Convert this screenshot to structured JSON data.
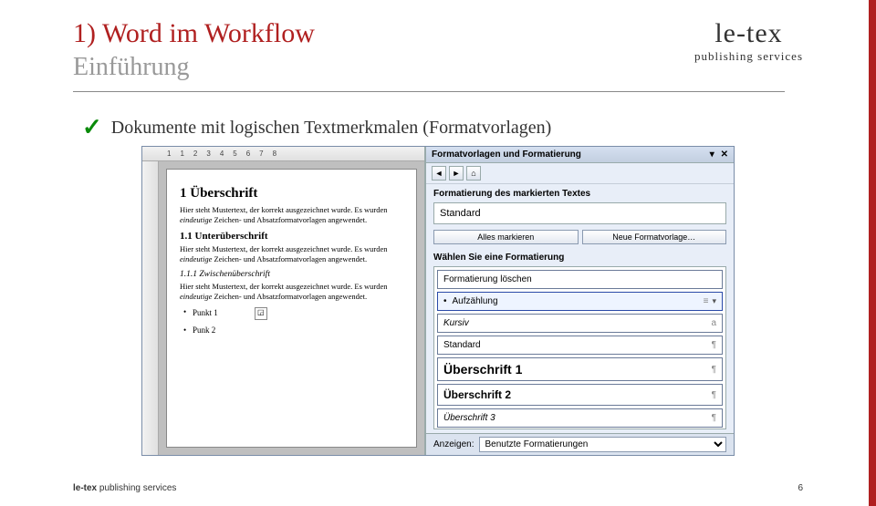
{
  "slide": {
    "title": "1) Word im Workflow",
    "subtitle": "Einführung",
    "bullet": "Dokumente mit logischen Textmerkmalen (Formatvorlagen)"
  },
  "logo": {
    "main": "le-tex",
    "sub": "publishing services"
  },
  "ruler": [
    "1",
    "1",
    "2",
    "3",
    "4",
    "5",
    "6",
    "7",
    "8"
  ],
  "doc": {
    "h1": "1 Überschrift",
    "p1a": "Hier steht Mustertext, der korrekt ausgezeichnet wurde. Es wurden ",
    "p1_em": "eindeutige",
    "p1b": " Zeichen- und Absatzformatvorlagen angewendet.",
    "h2": "1.1 Unterüberschrift",
    "p2a": "Hier steht Mustertext, der korrekt ausgezeichnet wurde. Es wurden ",
    "p2_em": "eindeutige",
    "p2b": " Zeichen- und Absatzformatvorlagen angewendet.",
    "h3": "1.1.1 Zwischenüberschrift",
    "p3a": "Hier steht Mustertext, der korrekt ausgezeichnet wurde. Es wurden ",
    "p3_em": "eindeutige",
    "p3b": " Zeichen- und Absatzformatvorlagen angewendet.",
    "b1": "Punkt 1",
    "b2": "Punk 2"
  },
  "taskpane": {
    "title": "Formatvorlagen und Formatierung",
    "section_current": "Formatierung des markierten Textes",
    "current_style": "Standard",
    "btn_select_all": "Alles markieren",
    "btn_new_style": "Neue Formatvorlage…",
    "section_pick": "Wählen Sie eine Formatierung",
    "items": [
      {
        "label": "Formatierung löschen",
        "mark": ""
      },
      {
        "label": "Aufzählung",
        "mark": "≡",
        "bul": "•",
        "selected": true
      },
      {
        "label": "Kursiv",
        "mark": "a",
        "kurs": true
      },
      {
        "label": "Standard",
        "mark": "¶"
      },
      {
        "label": "Überschrift 1",
        "mark": "¶",
        "big": true
      },
      {
        "label": "Überschrift 2",
        "mark": "¶",
        "mid": true
      },
      {
        "label": "Überschrift 3",
        "mark": "¶",
        "ital": true
      }
    ],
    "show_label": "Anzeigen:",
    "show_value": "Benutzte Formatierungen"
  },
  "footer": {
    "brand": "le-tex",
    "rest": " publishing services",
    "page": "6"
  }
}
